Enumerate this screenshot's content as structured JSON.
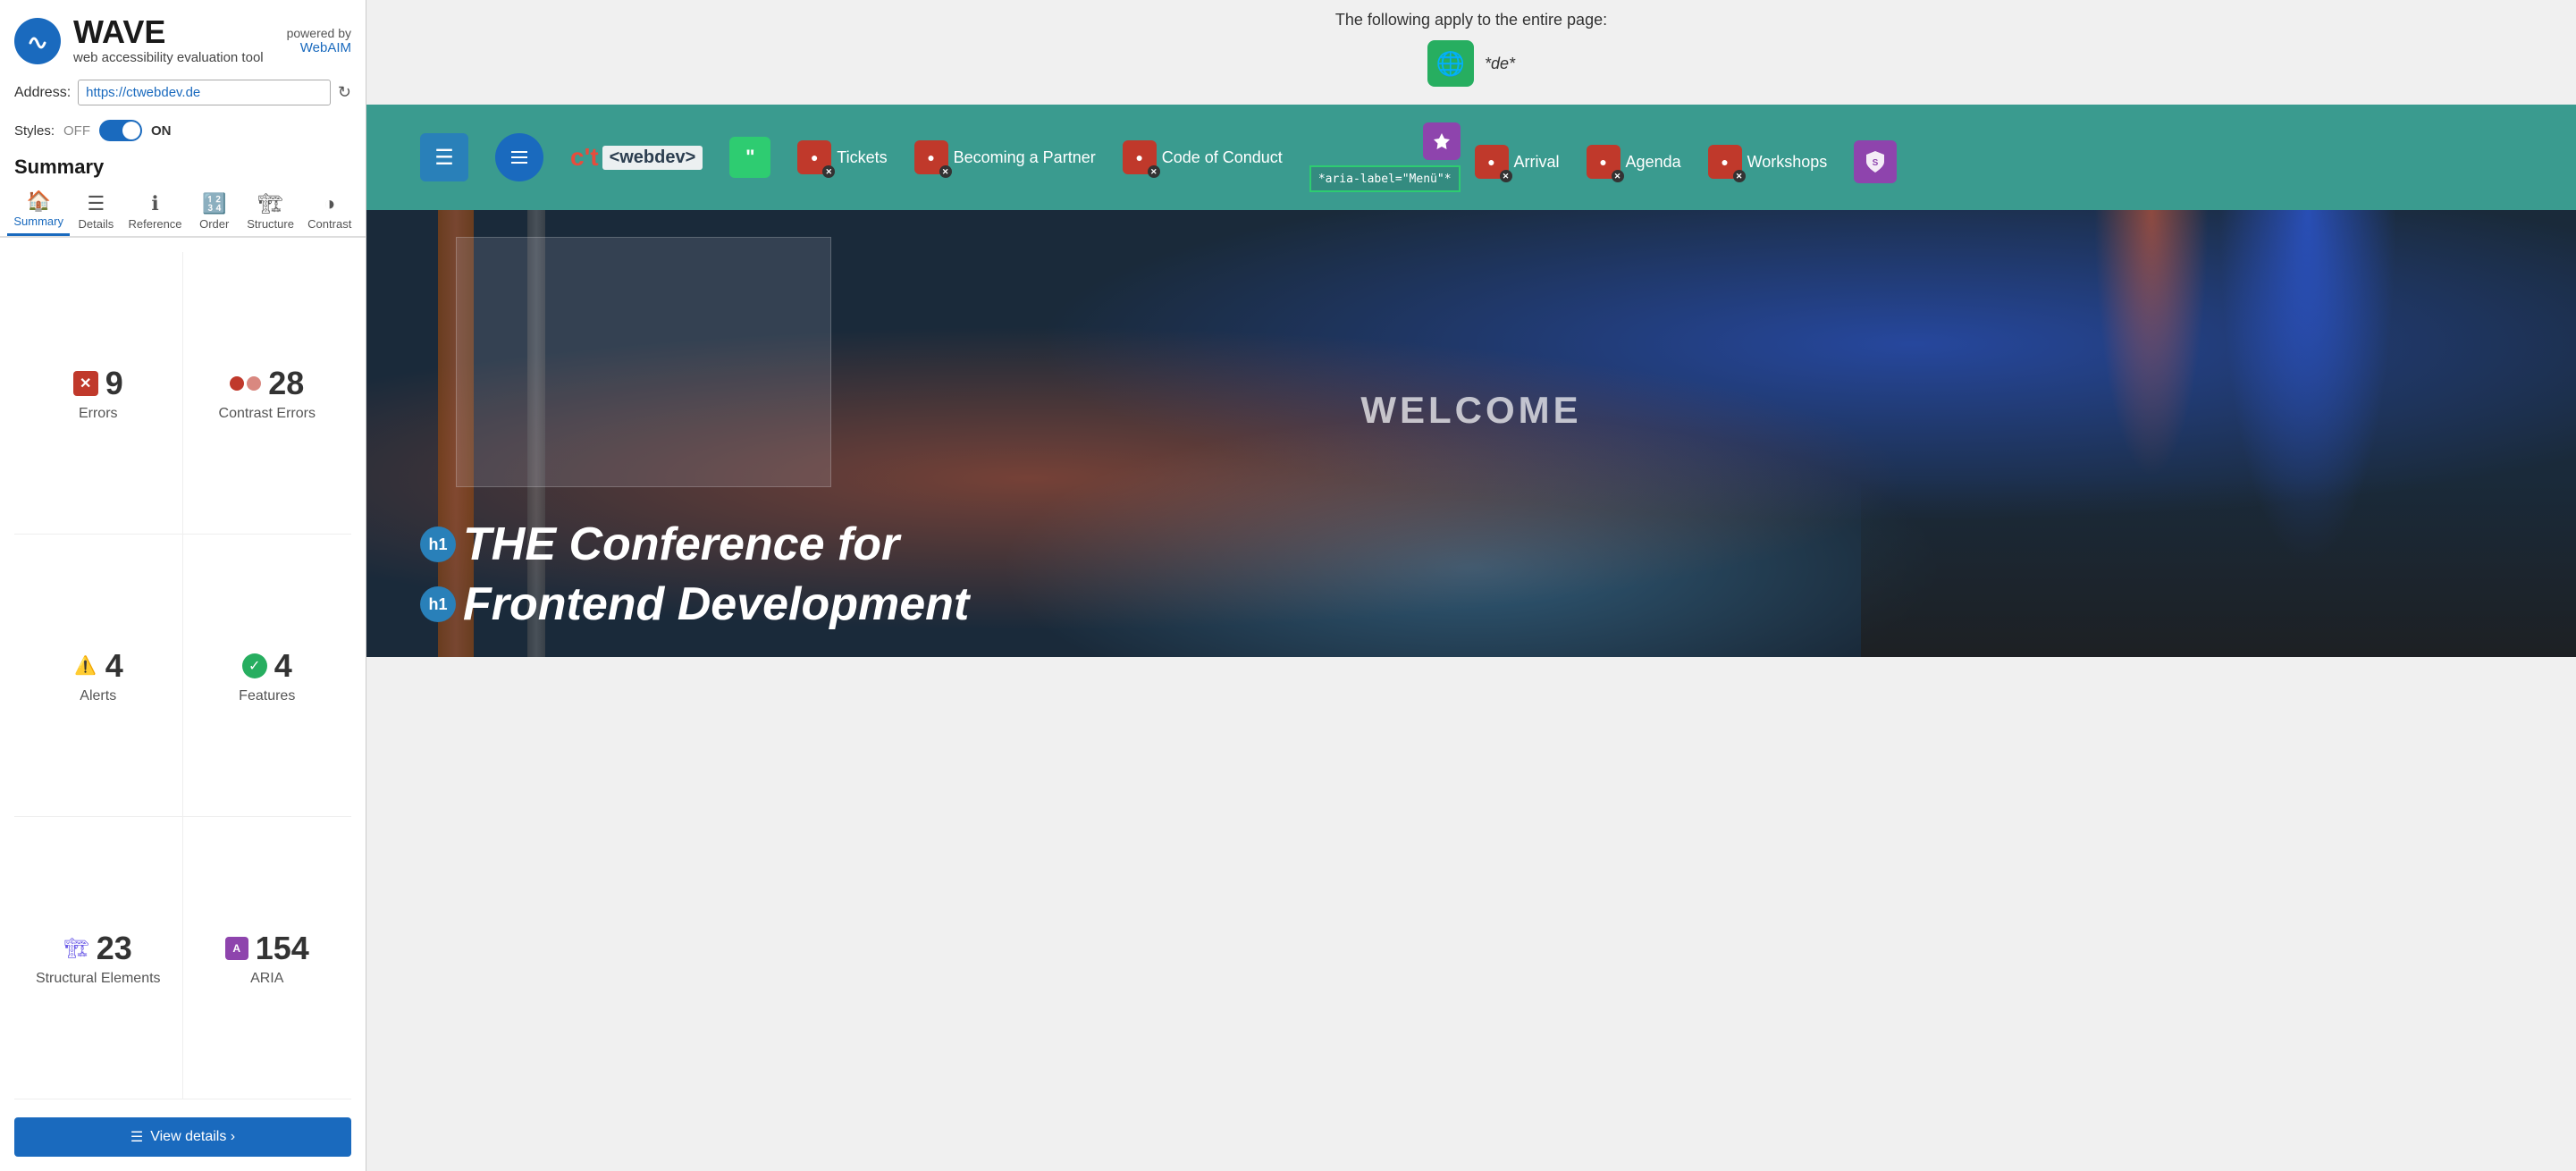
{
  "app": {
    "title": "WAVE",
    "subtitle": "web accessibility evaluation tool",
    "powered_by": "powered by",
    "webAIM_link": "WebAIM"
  },
  "address_bar": {
    "label": "Address:",
    "value": "https://ctwebdev.de"
  },
  "styles_toggle": {
    "label": "Styles:",
    "off_label": "OFF",
    "on_label": "ON"
  },
  "summary": {
    "heading": "Summary",
    "errors": {
      "count": "9",
      "label": "Errors"
    },
    "contrast_errors": {
      "count": "28",
      "label": "Contrast Errors"
    },
    "alerts": {
      "count": "4",
      "label": "Alerts"
    },
    "features": {
      "count": "4",
      "label": "Features"
    },
    "structural": {
      "count": "23",
      "label": "Structural Elements"
    },
    "aria": {
      "count": "154",
      "label": "ARIA"
    }
  },
  "tabs": [
    {
      "id": "summary",
      "label": "Summary",
      "icon": "🏠",
      "active": true
    },
    {
      "id": "details",
      "label": "Details",
      "icon": "☰",
      "active": false
    },
    {
      "id": "reference",
      "label": "Reference",
      "icon": "ℹ",
      "active": false
    },
    {
      "id": "order",
      "label": "Order",
      "icon": "🔢",
      "active": false
    },
    {
      "id": "structure",
      "label": "Structure",
      "icon": "🏗",
      "active": false
    },
    {
      "id": "contrast",
      "label": "Contrast",
      "icon": "◑",
      "active": false
    }
  ],
  "view_details_btn": "View details ›",
  "preview": {
    "top_info": "The following apply to the entire page:",
    "lang_badge": "*de*",
    "nav_items": [
      {
        "id": "tickets",
        "label": "Tickets"
      },
      {
        "id": "becoming_partner",
        "label": "Becoming a Partner"
      },
      {
        "id": "code_of_conduct",
        "label": "Code of Conduct"
      },
      {
        "id": "arrival",
        "label": "Arrival"
      },
      {
        "id": "agenda",
        "label": "Agenda"
      },
      {
        "id": "workshops",
        "label": "Workshops"
      }
    ],
    "aria_label": "*aria-label=\"Menü\"*",
    "welcome_text": "WELCOME",
    "hero_title_line1": "THE Conference for",
    "hero_title_line2": "Frontend Development",
    "h1_badge": "h1"
  }
}
